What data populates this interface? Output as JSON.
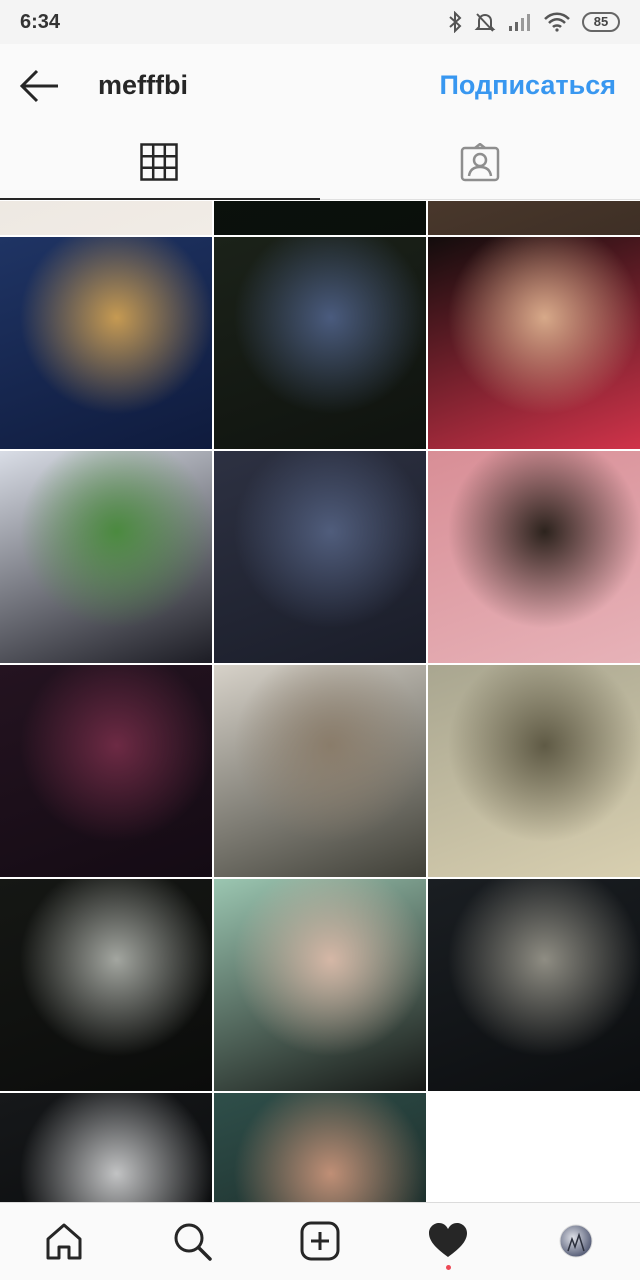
{
  "status_bar": {
    "time": "6:34",
    "battery": "85",
    "icons": [
      "bluetooth-icon",
      "notifications-muted-icon",
      "signal-icon",
      "wifi-icon",
      "battery-icon"
    ]
  },
  "header": {
    "username": "mefffbi",
    "subscribe_label": "Подписаться"
  },
  "tabs": [
    {
      "icon": "grid-icon",
      "active": true
    },
    {
      "icon": "tagged-photos-icon",
      "active": false
    }
  ],
  "grid": {
    "photos": [
      {
        "colors": [
          "#e9e3dc",
          "#d7c7b8",
          "#f1ece6"
        ]
      },
      {
        "colors": [
          "#0c140d",
          "#1c3321",
          "#0a0f0b"
        ]
      },
      {
        "colors": [
          "#5a4536",
          "#7a5e4a",
          "#3e2f25"
        ]
      },
      {
        "colors": [
          "#1f3464",
          "#c69a52",
          "#0f1b3d"
        ]
      },
      {
        "colors": [
          "#1b2219",
          "#4a5b7e",
          "#0f130f"
        ]
      },
      {
        "colors": [
          "#120c0c",
          "#d7a989",
          "#d0334a"
        ]
      },
      {
        "colors": [
          "#d9dde6",
          "#4b8a3f",
          "#1c1c24"
        ]
      },
      {
        "colors": [
          "#2d3142",
          "#505d7c",
          "#1a1d29"
        ]
      },
      {
        "colors": [
          "#d88e96",
          "#2c231d",
          "#e7b2b8"
        ]
      },
      {
        "colors": [
          "#241320",
          "#6d2a44",
          "#140b14"
        ]
      },
      {
        "colors": [
          "#d7d2c9",
          "#8a7c6a",
          "#404038"
        ]
      },
      {
        "colors": [
          "#a9a690",
          "#5f5a45",
          "#d8cfb0"
        ]
      },
      {
        "colors": [
          "#151714",
          "#a3a6a0",
          "#0b0c0b"
        ]
      },
      {
        "colors": [
          "#9bc6b1",
          "#d5b7a6",
          "#151715"
        ]
      },
      {
        "colors": [
          "#1a1e22",
          "#8f8d83",
          "#0c0e10"
        ]
      },
      {
        "colors": [
          "#16181a",
          "#c2c3c4",
          "#070809"
        ]
      },
      {
        "colors": [
          "#2f4f4a",
          "#c08f76",
          "#141f1d"
        ]
      }
    ]
  },
  "bottom_nav": {
    "items": [
      {
        "icon": "home-icon"
      },
      {
        "icon": "search-icon"
      },
      {
        "icon": "new-post-icon"
      },
      {
        "icon": "activity-heart-icon",
        "has_notification_dot": true
      },
      {
        "icon": "profile-avatar-icon"
      }
    ]
  },
  "theme": {
    "accent": "#3897f0",
    "notification": "#ed4956",
    "text": "#262626"
  }
}
